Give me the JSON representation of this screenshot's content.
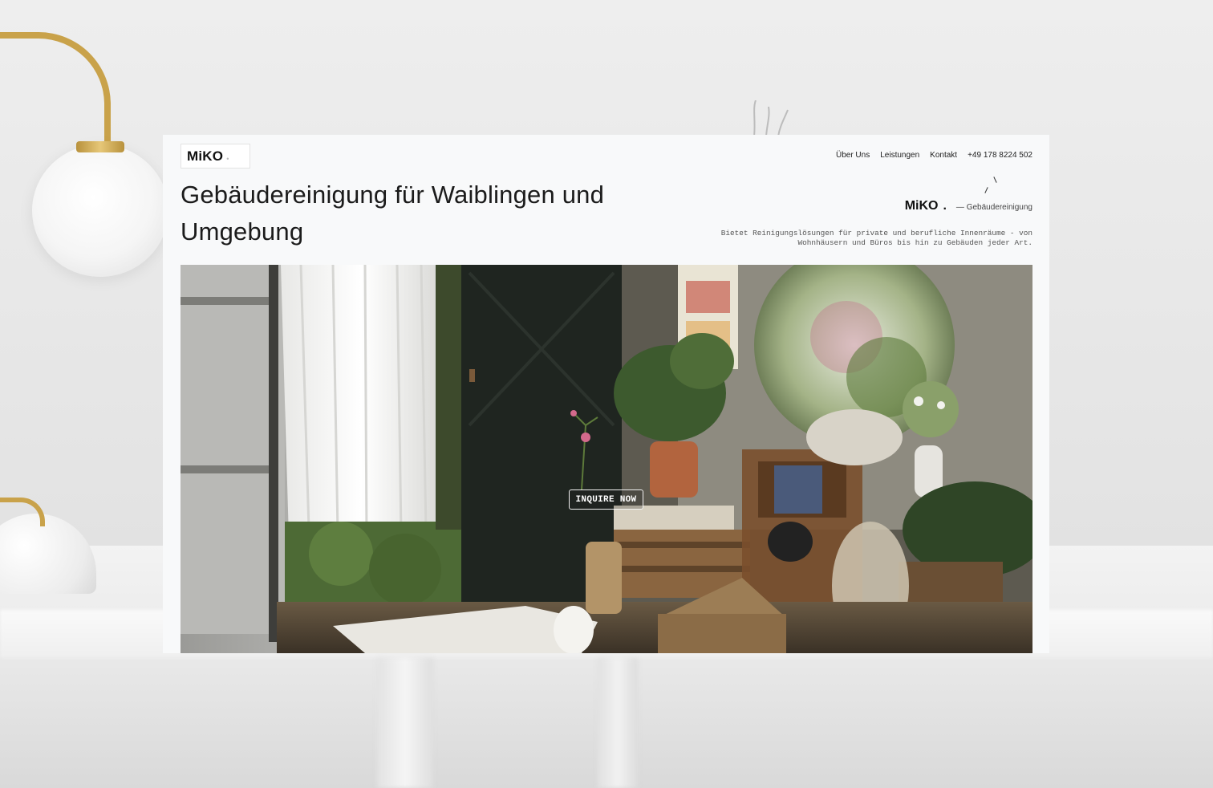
{
  "site": {
    "logo": "MiKO",
    "nav": {
      "about": "Über Uns",
      "services": "Leistungen",
      "contact": "Kontakt",
      "phone": "+49 178 8224 502"
    },
    "headline": "Gebäudereinigung für Waiblingen und Umgebung",
    "brand": {
      "name": "MiKO",
      "dot": ".",
      "tagline": "— Gebäudereinigung"
    },
    "description": "Bietet Reinigungslösungen für private und berufliche Innenräume - von Wohnhäusern und Büros bis hin zu Gebäuden jeder Art.",
    "hero": {
      "cta_label": "INQUIRE NOW"
    }
  },
  "colors": {
    "card_bg": "#f8f9fa",
    "text": "#1b1b1b",
    "lamp_gold": "#c9a24a"
  }
}
